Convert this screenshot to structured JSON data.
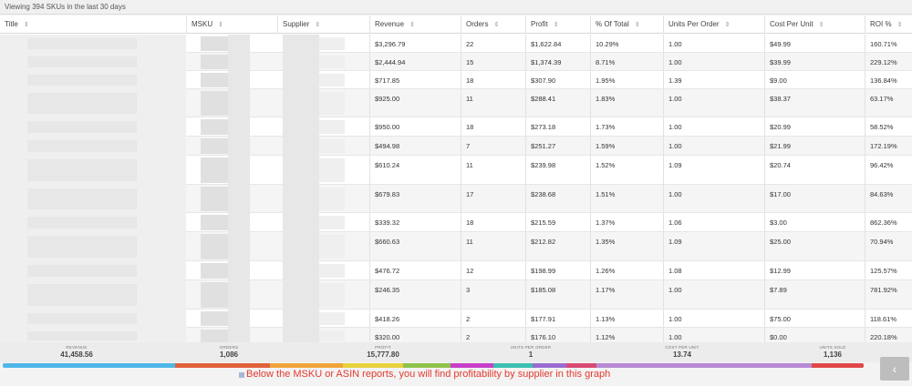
{
  "header_text": "Viewing 394 SKUs in the last 30 days",
  "columns": [
    {
      "label": "Title",
      "sort_icon": "⇕"
    },
    {
      "label": "MSKU",
      "sort_icon": "⇕"
    },
    {
      "label": "Supplier",
      "sort_icon": "⇕"
    },
    {
      "label": "Revenue",
      "sort_icon": "⇕"
    },
    {
      "label": "Orders",
      "sort_icon": "⇕"
    },
    {
      "label": "Profit",
      "sort_icon": "⇕"
    },
    {
      "label": "% Of Total",
      "sort_icon": "⇕"
    },
    {
      "label": "Units Per Order",
      "sort_icon": "⇕"
    },
    {
      "label": "Cost Per Unit",
      "sort_icon": "⇕"
    },
    {
      "label": "ROI %",
      "sort_icon": "⇕"
    }
  ],
  "rows": [
    {
      "revenue": "$3,296.79",
      "orders": "22",
      "profit": "$1,622.84",
      "pct": "10.29%",
      "upo": "1.00",
      "cpu": "$49.99",
      "roi": "160.71%"
    },
    {
      "revenue": "$2,444.94",
      "orders": "15",
      "profit": "$1,374.39",
      "pct": "8.71%",
      "upo": "1.00",
      "cpu": "$39.99",
      "roi": "229.12%"
    },
    {
      "revenue": "$717.85",
      "orders": "18",
      "profit": "$307.90",
      "pct": "1.95%",
      "upo": "1.39",
      "cpu": "$9.00",
      "roi": "136.84%"
    },
    {
      "revenue": "$925.00",
      "orders": "11",
      "profit": "$288.41",
      "pct": "1.83%",
      "upo": "1.00",
      "cpu": "$38.37",
      "roi": "63.17%"
    },
    {
      "revenue": "$950.00",
      "orders": "18",
      "profit": "$273.18",
      "pct": "1.73%",
      "upo": "1.00",
      "cpu": "$20.99",
      "roi": "58.52%"
    },
    {
      "revenue": "$494.98",
      "orders": "7",
      "profit": "$251.27",
      "pct": "1.59%",
      "upo": "1.00",
      "cpu": "$21.99",
      "roi": "172.19%"
    },
    {
      "revenue": "$610.24",
      "orders": "11",
      "profit": "$239.98",
      "pct": "1.52%",
      "upo": "1.09",
      "cpu": "$20.74",
      "roi": "96.42%"
    },
    {
      "revenue": "$679.83",
      "orders": "17",
      "profit": "$238.68",
      "pct": "1.51%",
      "upo": "1.00",
      "cpu": "$17.00",
      "roi": "84.63%"
    },
    {
      "revenue": "$339.32",
      "orders": "18",
      "profit": "$215.59",
      "pct": "1.37%",
      "upo": "1.06",
      "cpu": "$3.00",
      "roi": "862.36%"
    },
    {
      "revenue": "$660.63",
      "orders": "11",
      "profit": "$212.82",
      "pct": "1.35%",
      "upo": "1.09",
      "cpu": "$25.00",
      "roi": "70.94%"
    },
    {
      "revenue": "$476.72",
      "orders": "12",
      "profit": "$198.99",
      "pct": "1.26%",
      "upo": "1.08",
      "cpu": "$12.99",
      "roi": "125.57%"
    },
    {
      "revenue": "$246.35",
      "orders": "3",
      "profit": "$185.08",
      "pct": "1.17%",
      "upo": "1.00",
      "cpu": "$7.89",
      "roi": "781.92%"
    },
    {
      "revenue": "$418.26",
      "orders": "2",
      "profit": "$177.91",
      "pct": "1.13%",
      "upo": "1.00",
      "cpu": "$75.00",
      "roi": "118.61%"
    },
    {
      "revenue": "$320.00",
      "orders": "2",
      "profit": "$176.10",
      "pct": "1.12%",
      "upo": "1.00",
      "cpu": "$0.00",
      "roi": "220.18%"
    }
  ],
  "summary": [
    {
      "label": "Revenue",
      "value": "41,458.56"
    },
    {
      "label": "Orders",
      "value": "1,086"
    },
    {
      "label": "Profit",
      "value": "15,777.80"
    },
    {
      "label": "Units Per Order",
      "value": "1"
    },
    {
      "label": "Cost Per Unit",
      "value": "13.74"
    },
    {
      "label": "Units Sold",
      "value": "1,136"
    }
  ],
  "supplier_bar_colors": [
    "#4fb6e8",
    "#e0623b",
    "#f0a43a",
    "#e8d23c",
    "#8ec24a",
    "#c83fc8",
    "#3bbfb0",
    "#9a6bd0",
    "#d94a73",
    "#b88ad4",
    "#e04848"
  ],
  "supplier_bar_shares": [
    0.2,
    0.11,
    0.085,
    0.07,
    0.055,
    0.05,
    0.045,
    0.04,
    0.035,
    0.25,
    0.06
  ],
  "caption": "Below the MSKU or ASIN reports, you will find profitability by supplier in this graph",
  "nav_button_icon": "‹"
}
